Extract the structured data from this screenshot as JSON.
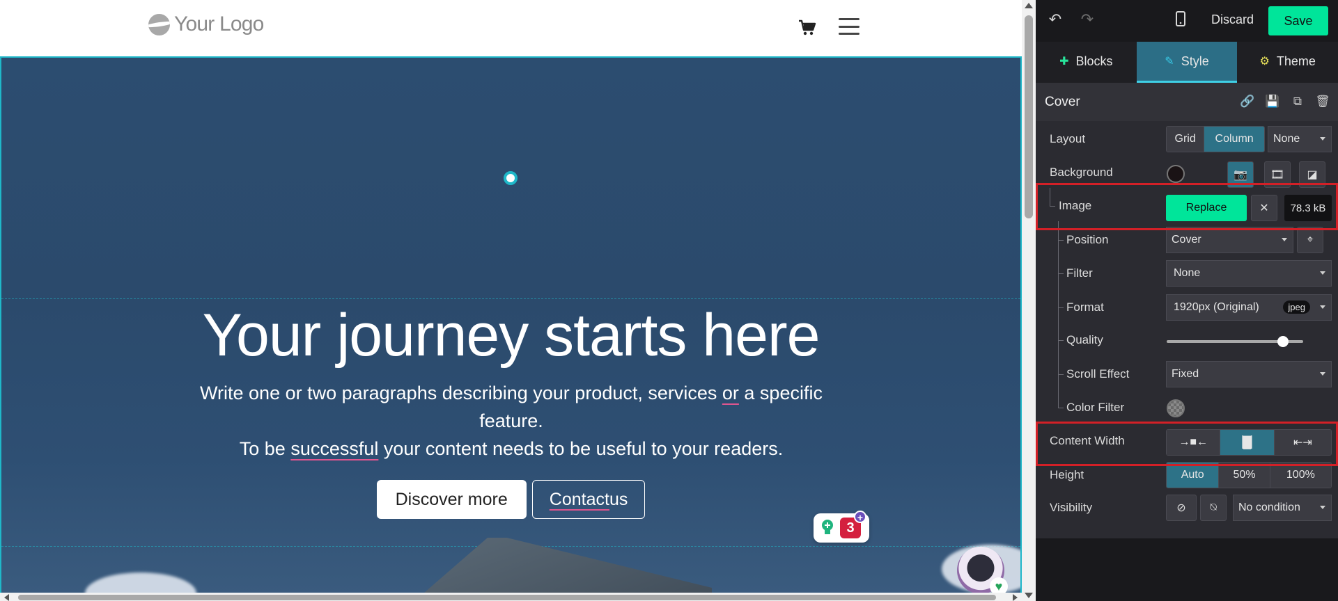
{
  "site": {
    "logo_text": "Your Logo",
    "hero": {
      "title": "Your journey starts here",
      "paragraph_1a": "Write one or two paragraphs describing your product, services ",
      "paragraph_1b": "or",
      "paragraph_1c": " a specific feature.",
      "paragraph_2a": "To be ",
      "paragraph_2b": "successful",
      "paragraph_2c": " your content needs to be useful to your readers.",
      "primary_button": "Discover more",
      "secondary_button_a": "Contact",
      "secondary_button_b": " us"
    },
    "notification_count": "3",
    "notification_plus": "+"
  },
  "editor": {
    "topbar": {
      "discard_label": "Discard",
      "save_label": "Save"
    },
    "tabs": [
      {
        "label": "Blocks",
        "icon": "plus-icon",
        "active": false
      },
      {
        "label": "Style",
        "icon": "pencil-icon",
        "active": true
      },
      {
        "label": "Theme",
        "icon": "gear-icon",
        "active": false
      }
    ],
    "section": {
      "title": "Cover",
      "layout": {
        "label": "Layout",
        "options": [
          "Grid",
          "Column"
        ],
        "selected": "Column",
        "dropdown": "None"
      },
      "background": {
        "label": "Background",
        "color": "#1a1315"
      },
      "image": {
        "label": "Image",
        "replace_label": "Replace",
        "remove_glyph": "✕",
        "size": "78.3 kB"
      },
      "position": {
        "label": "Position",
        "value": "Cover"
      },
      "filter": {
        "label": "Filter",
        "value": "None"
      },
      "format": {
        "label": "Format",
        "value": "1920px (Original)",
        "badge": "jpeg"
      },
      "quality": {
        "label": "Quality",
        "value_fraction": 0.85
      },
      "scroll_effect": {
        "label": "Scroll Effect",
        "value": "Fixed"
      },
      "color_filter": {
        "label": "Color Filter"
      },
      "content_width": {
        "label": "Content Width",
        "options": [
          "small",
          "regular",
          "full"
        ],
        "selected": "regular"
      },
      "height": {
        "label": "Height",
        "options": [
          "Auto",
          "50%",
          "100%"
        ],
        "selected": "Auto"
      },
      "visibility": {
        "label": "Visibility",
        "dropdown": "No condition"
      }
    }
  },
  "colors": {
    "accent_green": "#00e59a",
    "accent_teal": "#1fb8c9",
    "active_segment": "#2d7287",
    "highlight_red": "#d32027",
    "panel_bg": "#2b2b31"
  }
}
